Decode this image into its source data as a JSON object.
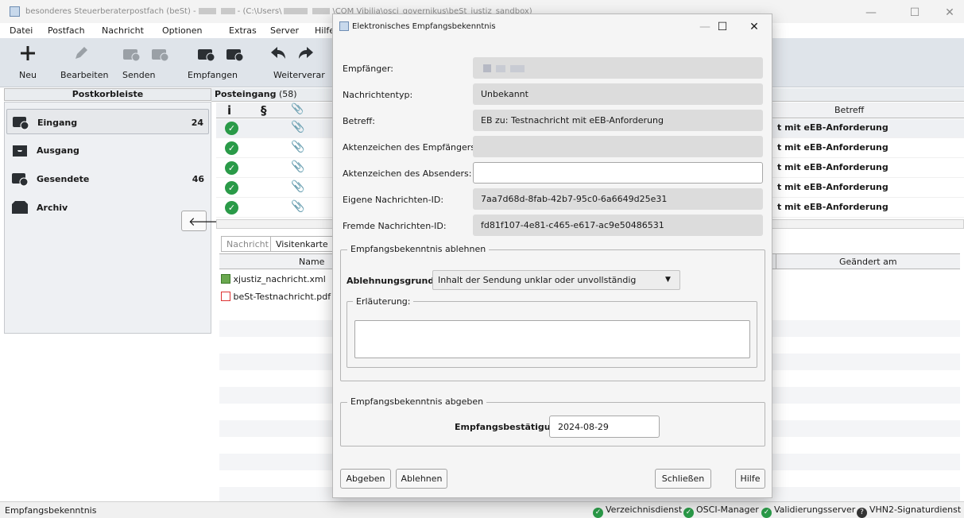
{
  "window": {
    "title_prefix": "besonderes Steuerberaterpostfach (beSt) -",
    "title_path1": "- (C:\\Users\\",
    "title_path2": "\\COM Vibilia\\osci_governikus\\beSt_justiz_sandbox)",
    "minimize": "—",
    "maximize": "☐",
    "close": "✕"
  },
  "menu": [
    "Datei",
    "Postfach",
    "Nachricht",
    "Optionen",
    "Extras",
    "Server",
    "Hilfe"
  ],
  "toolbar": {
    "new": "Neu",
    "edit": "Bearbeiten",
    "send": "Senden",
    "receive": "Empfangen",
    "forward": "Weiterverar"
  },
  "sidebar": {
    "header": "Postkorbleiste",
    "items": [
      {
        "label": "Eingang",
        "count": "24"
      },
      {
        "label": "Ausgang",
        "count": ""
      },
      {
        "label": "Gesendete",
        "count": "46"
      },
      {
        "label": "Archiv",
        "count": ""
      }
    ],
    "back_arrow": "🡐"
  },
  "inbox": {
    "title": "Posteingang",
    "count": "(58)",
    "columns": {
      "info": "i",
      "para": "§",
      "attach": "📎",
      "subject": "Betreff"
    },
    "rows": [
      {
        "subject": "t mit eEB-Anforderung"
      },
      {
        "subject": "t mit eEB-Anforderung"
      },
      {
        "subject": "t mit eEB-Anforderung"
      },
      {
        "subject": "t mit eEB-Anforderung"
      },
      {
        "subject": "t mit eEB-Anforderung"
      }
    ]
  },
  "details": {
    "tabs": [
      "Nachricht",
      "Visitenkarte"
    ],
    "columns": {
      "name": "Name",
      "changed": "Geändert am"
    },
    "files": [
      "xjustiz_nachricht.xml",
      "beSt-Testnachricht.pdf"
    ]
  },
  "statusbar": {
    "left": "Empfangsbekenntnis",
    "services": [
      "Verzeichnisdienst",
      "OSCI-Manager",
      "Validierungsserver",
      "VHN2-Signaturdienst"
    ]
  },
  "dialog": {
    "title": "Elektronisches Empfangsbekenntnis",
    "fields": [
      {
        "label": "Empfänger:",
        "value": ""
      },
      {
        "label": "Nachrichtentyp:",
        "value": "Unbekannt"
      },
      {
        "label": "Betreff:",
        "value": "EB zu: Testnachricht mit eEB-Anforderung"
      },
      {
        "label": "Aktenzeichen des Empfängers:",
        "value": ""
      },
      {
        "label": "Aktenzeichen des Absenders:",
        "value": ""
      },
      {
        "label": "Eigene Nachrichten-ID:",
        "value": "7aa7d68d-8fab-42b7-95c0-6a6649d25e31"
      },
      {
        "label": "Fremde Nachrichten-ID:",
        "value": "fd81f107-4e81-c465-e617-ac9e50486531"
      }
    ],
    "reject_group": "Empfangsbekenntnis ablehnen",
    "reject_reason_label": "Ablehnungsgrund:",
    "reject_reason_value": "Inhalt der Sendung unklar oder unvollständig",
    "explanation_label": "Erläuterung:",
    "submit_group": "Empfangsbekenntnis abgeben",
    "receipt_label": "Empfangsbestätigung:",
    "receipt_date": "2024-08-29",
    "buttons": {
      "submit": "Abgeben",
      "reject": "Ablehnen",
      "close": "Schließen",
      "help": "Hilfe"
    }
  }
}
